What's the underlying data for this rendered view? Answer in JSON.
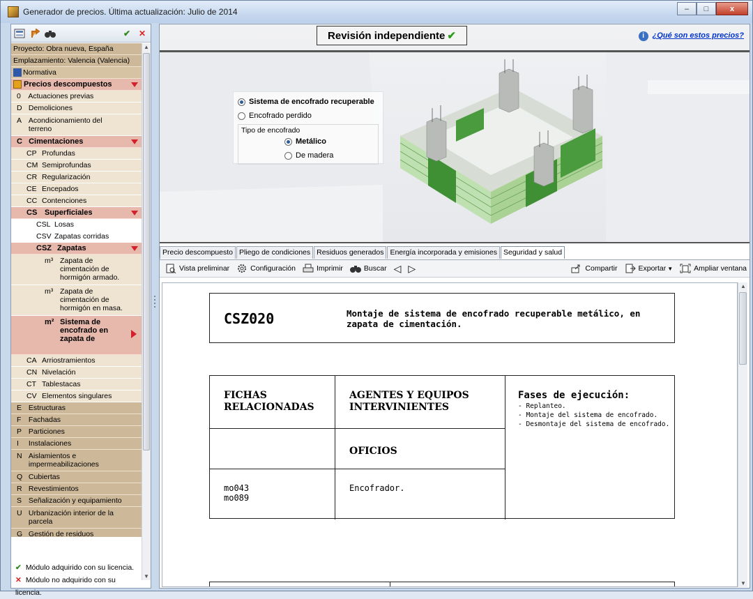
{
  "window": {
    "title": "Generador de precios. Última actualización: Julio de 2014",
    "controls": [
      "–",
      "□",
      "x"
    ]
  },
  "left_panel": {
    "toolbar_check": "✔",
    "toolbar_close": "✕",
    "project": "Proyecto: Obra nueva, España",
    "location": "Emplazamiento: Valencia (Valencia)",
    "normativa": "Normativa",
    "precios": "Precios descompuestos",
    "items": [
      {
        "code": "0",
        "label": "Actuaciones previas"
      },
      {
        "code": "D",
        "label": "Demoliciones"
      },
      {
        "code": "A",
        "label": "Acondicionamiento del terreno"
      }
    ],
    "cimentaciones": {
      "code": "C",
      "label": "Cimentaciones"
    },
    "cim_items": [
      {
        "code": "CP",
        "label": "Profundas"
      },
      {
        "code": "CM",
        "label": "Semiprofundas"
      },
      {
        "code": "CR",
        "label": "Regularización"
      },
      {
        "code": "CE",
        "label": "Encepados"
      },
      {
        "code": "CC",
        "label": "Contenciones"
      }
    ],
    "superficiales": {
      "code": "CS",
      "label": "Superficiales"
    },
    "sup_items": [
      {
        "code": "CSL",
        "label": "Losas"
      },
      {
        "code": "CSV",
        "label": "Zapatas corridas"
      }
    ],
    "zapatas": {
      "code": "CSZ",
      "label": "Zapatas"
    },
    "zap_items": [
      {
        "unit": "m³",
        "label": "Zapata de cimentación de hormigón armado."
      },
      {
        "unit": "m³",
        "label": "Zapata de cimentación de hormigón en masa."
      },
      {
        "unit": "m²",
        "label": "Sistema de encofrado en zapata de"
      }
    ],
    "cim_items2": [
      {
        "code": "CA",
        "label": "Arriostramientos"
      },
      {
        "code": "CN",
        "label": "Nivelación"
      },
      {
        "code": "CT",
        "label": "Tablestacas"
      },
      {
        "code": "CV",
        "label": "Elementos singulares"
      }
    ],
    "items2": [
      {
        "code": "E",
        "label": "Estructuras"
      },
      {
        "code": "F",
        "label": "Fachadas"
      },
      {
        "code": "P",
        "label": "Particiones"
      },
      {
        "code": "I",
        "label": "Instalaciones"
      },
      {
        "code": "N",
        "label": "Aislamientos e impermeabilizaciones"
      },
      {
        "code": "Q",
        "label": "Cubiertas"
      },
      {
        "code": "R",
        "label": "Revestimientos"
      },
      {
        "code": "S",
        "label": "Señalización y equipamiento"
      },
      {
        "code": "U",
        "label": "Urbanización interior de la parcela"
      },
      {
        "code": "G",
        "label": "Gestión de residuos"
      }
    ],
    "legend": {
      "acquired": "Módulo adquirido con su licencia.",
      "not_acquired": "Módulo no adquirido con su licencia."
    }
  },
  "main": {
    "revision": "Revisión independiente",
    "revision_check": "✔",
    "que_son": "¿Qué son estos precios?",
    "options": {
      "recuperable": "Sistema de encofrado recuperable",
      "perdido": "Encofrado perdido",
      "tipo_label": "Tipo de encofrado",
      "metalico": "Metálico",
      "madera": "De madera"
    },
    "tabs": [
      "Precio descompuesto",
      "Pliego de condiciones",
      "Residuos generados",
      "Energía incorporada y emisiones",
      "Seguridad y salud"
    ],
    "toolbar": {
      "vista": "Vista preliminar",
      "config": "Configuración",
      "imprimir": "Imprimir",
      "buscar": "Buscar",
      "compartir": "Compartir",
      "exportar": "Exportar",
      "ampliar": "Ampliar ventana"
    },
    "document": {
      "code": "CSZ020",
      "description": "Montaje de sistema de encofrado recuperable metálico, en zapata de cimentación.",
      "col1_header": "FICHAS RELACIONADAS",
      "col2_header": "AGENTES Y EQUIPOS INTERVINIENTES",
      "oficios": "OFICIOS",
      "fichas": "mo043\nmo089",
      "encofrador": "Encofrador.",
      "fases_title": "Fases de ejecución:",
      "fases": [
        "- Replanteo.",
        "- Montaje del sistema de encofrado.",
        "- Desmontaje del sistema de encofrado."
      ]
    }
  },
  "colors": {
    "tree_tan": "#cdb99a",
    "tree_pink": "#e7b9ad",
    "accent_red": "#d3202a",
    "ok_green": "#2d8a1c",
    "link_blue": "#0033cc"
  }
}
